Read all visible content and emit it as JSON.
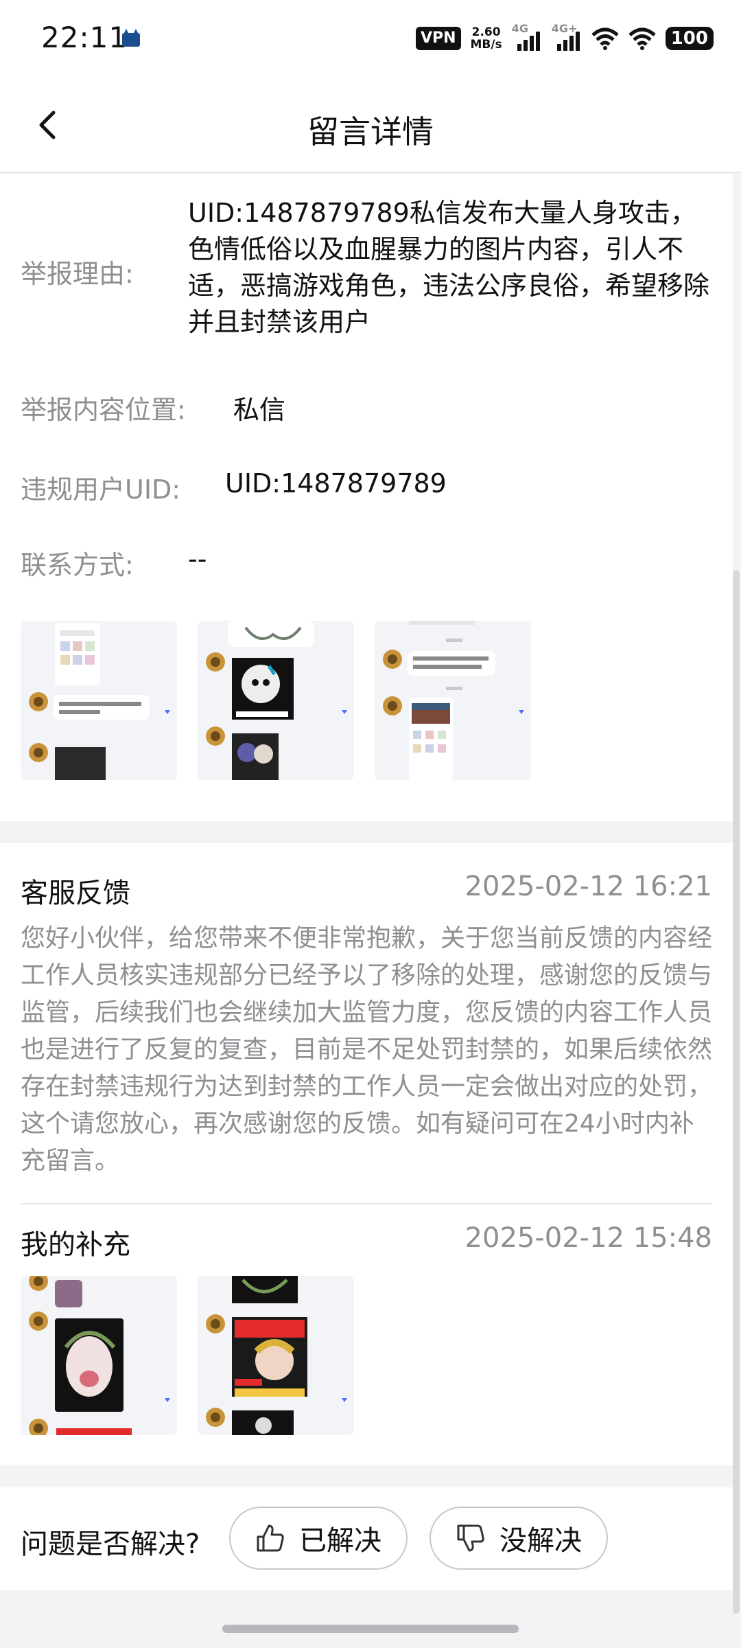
{
  "status_bar": {
    "time": "22:11",
    "vpn": "VPN",
    "speed_value": "2.60",
    "speed_unit": "MB/s",
    "sim1": "4G",
    "sim2": "4G+",
    "battery": "100"
  },
  "nav": {
    "title": "留言详情"
  },
  "report": {
    "reason_label": "举报理由:",
    "reason_text": "UID:1487879789私信发布大量人身攻击，色情低俗以及血腥暴力的图片内容，引人不适，恶搞游戏角色，违法公序良俗，希望移除并且封禁该用户",
    "location_label": "举报内容位置:",
    "location_value": "私信",
    "uid_label": "违规用户UID:",
    "uid_value": "UID:1487879789",
    "contact_label": "联系方式:",
    "contact_value": "--"
  },
  "feedback": {
    "title": "客服反馈",
    "time": "2025-02-12 16:21",
    "text": "您好小伙伴，给您带来不便非常抱歉，关于您当前反馈的内容经工作人员核实违规部分已经予以了移除的处理，感谢您的反馈与监管，后续我们也会继续加大监管力度，您反馈的内容工作人员也是进行了反复的复查，目前是不足处罚封禁的，如果后续依然存在封禁违规行为达到封禁的工作人员一定会做出对应的处罚，这个请您放心，再次感谢您的反馈。如有疑问可在24小时内补充留言。"
  },
  "supplement": {
    "title": "我的补充",
    "time": "2025-02-12 15:48"
  },
  "resolve": {
    "question": "问题是否解决?",
    "yes_label": "已解决",
    "no_label": "没解决"
  }
}
